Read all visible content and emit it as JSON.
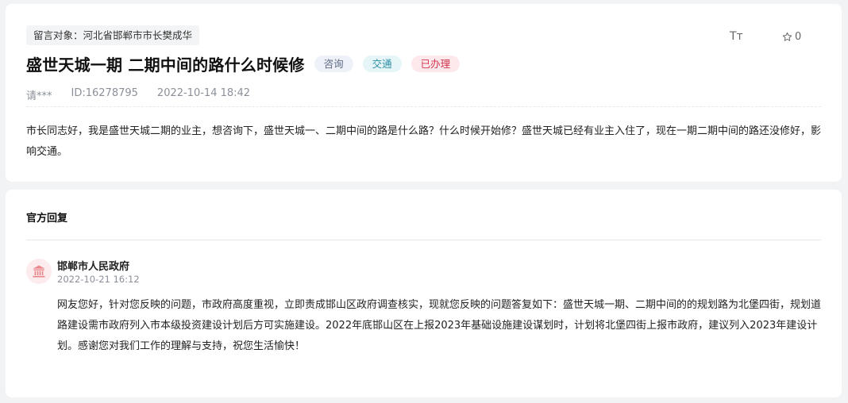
{
  "message": {
    "target": "留言对象：河北省邯郸市市长樊成华",
    "title": "盛世天城一期 二期中间的路什么时候修",
    "tags": [
      "咨询",
      "交通",
      "已办理"
    ],
    "font_size_label": "Tт",
    "favorite_count": "0",
    "author": "请***",
    "id": "ID:16278795",
    "datetime": "2022-10-14 18:42",
    "content": "市长同志好，我是盛世天城二期的业主，想咨询下，盛世天城一、二期中间的路是什么路？什么时候开始修？盛世天城已经有业主入住了，现在一期二期中间的路还没修好，影响交通。"
  },
  "reply": {
    "heading": "官方回复",
    "org_name": "邯郸市人民政府",
    "datetime": "2022-10-21 16:12",
    "content": "网友您好，针对您反映的问题，市政府高度重视，立即责成邯山区政府调查核实，现就您反映的问题答复如下：盛世天城一期、二期中间的的规划路为北堡四街，规划道路建设需市政府列入市本级投资建设计划后方可实施建设。2022年底邯山区在上报2023年基础设施建设谋划时，计划将北堡四街上报市政府，建议列入2023年建设计划。感谢您对我们工作的理解与支持，祝您生活愉快！"
  },
  "colors": {
    "tag_consult": "#5d6b85",
    "tag_traffic": "#2e8fa6",
    "tag_done": "#d2354e",
    "avatar_icon": "#e8878c"
  },
  "icons": {
    "font_size": "font-size-icon",
    "favorite": "star-icon",
    "avatar": "government-building-icon"
  }
}
